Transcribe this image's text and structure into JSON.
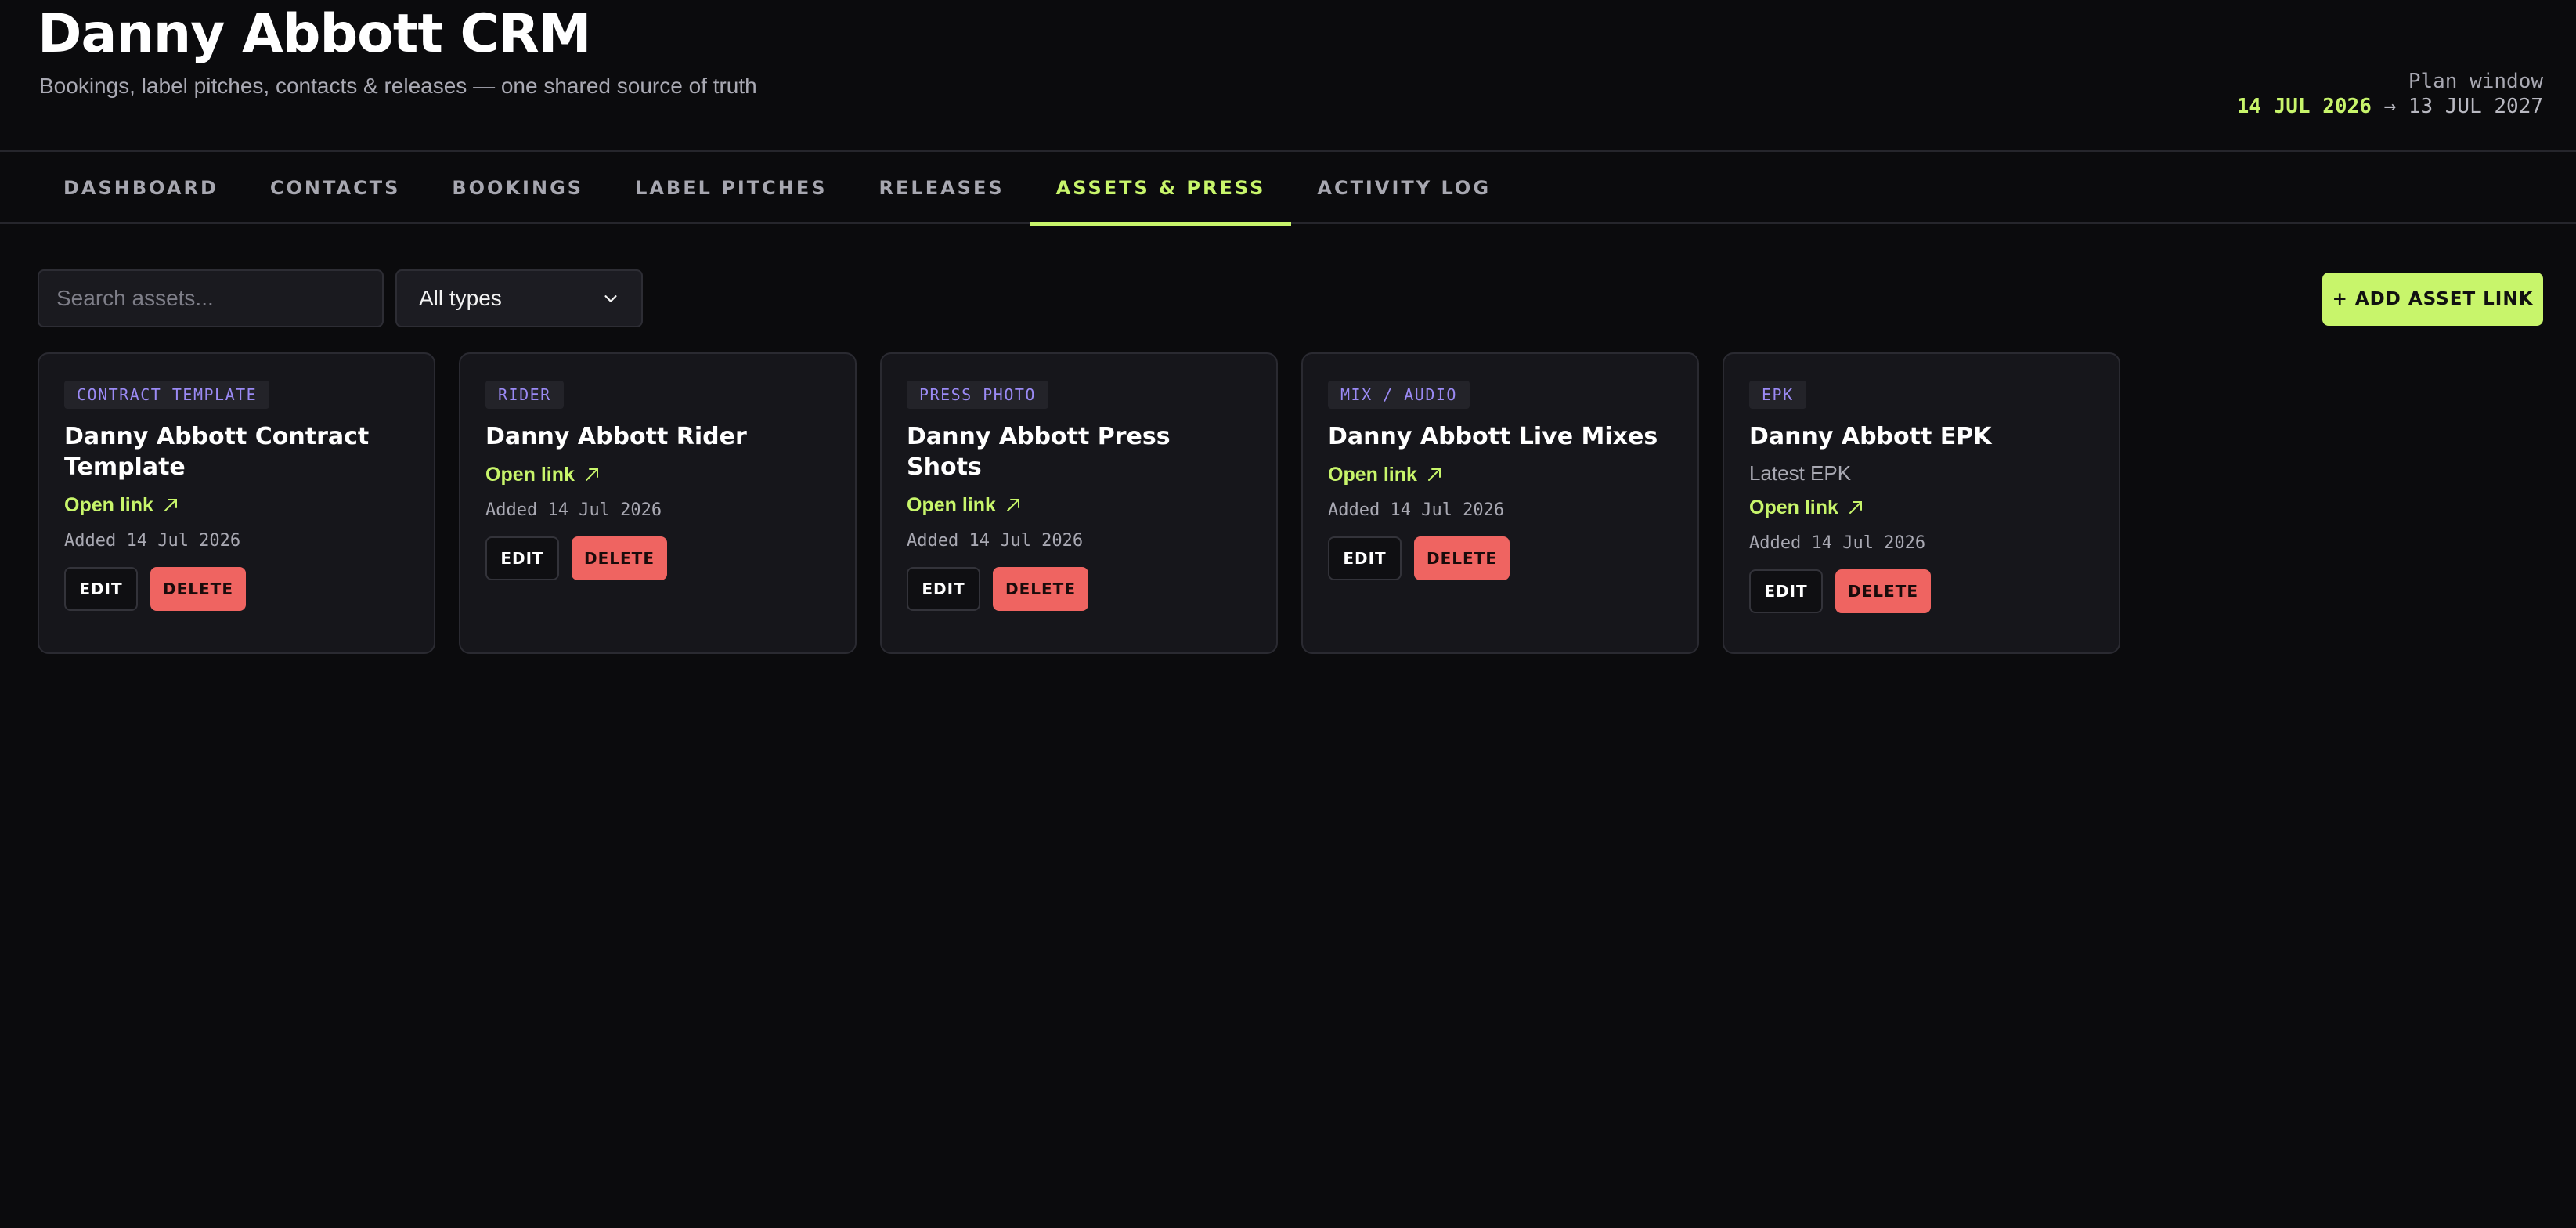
{
  "header": {
    "title": "Danny Abbott CRM",
    "subtitle": "Bookings, label pitches, contacts & releases — one shared source of truth",
    "plan_window": {
      "label": "Plan window",
      "start": "14 JUL 2026",
      "separator": " → ",
      "end": "13 JUL 2027"
    }
  },
  "tabs": [
    {
      "label": "DASHBOARD"
    },
    {
      "label": "CONTACTS"
    },
    {
      "label": "BOOKINGS"
    },
    {
      "label": "LABEL PITCHES"
    },
    {
      "label": "RELEASES"
    },
    {
      "label": "ASSETS & PRESS",
      "active": true
    },
    {
      "label": "ACTIVITY LOG"
    }
  ],
  "toolbar": {
    "search_placeholder": "Search assets...",
    "type_filter": "All types",
    "add_button": "+ ADD ASSET LINK"
  },
  "colors": {
    "accent": "#c8f56b",
    "badge_text": "#9b8af5",
    "delete": "#ef6461",
    "background": "#0b0b0d",
    "card": "#16161b"
  },
  "assets": [
    {
      "type": "CONTRACT TEMPLATE",
      "title": "Danny Abbott Contract Template",
      "note": "",
      "link_label": "Open link",
      "added": "Added 14 Jul 2026",
      "edit_label": "EDIT",
      "delete_label": "DELETE"
    },
    {
      "type": "RIDER",
      "title": "Danny Abbott Rider",
      "note": "",
      "link_label": "Open link",
      "added": "Added 14 Jul 2026",
      "edit_label": "EDIT",
      "delete_label": "DELETE"
    },
    {
      "type": "PRESS PHOTO",
      "title": "Danny Abbott Press Shots",
      "note": "",
      "link_label": "Open link",
      "added": "Added 14 Jul 2026",
      "edit_label": "EDIT",
      "delete_label": "DELETE"
    },
    {
      "type": "MIX / AUDIO",
      "title": "Danny Abbott Live Mixes",
      "note": "",
      "link_label": "Open link",
      "added": "Added 14 Jul 2026",
      "edit_label": "EDIT",
      "delete_label": "DELETE"
    },
    {
      "type": "EPK",
      "title": "Danny Abbott EPK",
      "note": "Latest EPK",
      "link_label": "Open link",
      "added": "Added 14 Jul 2026",
      "edit_label": "EDIT",
      "delete_label": "DELETE"
    }
  ],
  "icons": {
    "open_link": "external-link-arrow-icon",
    "select": "chevron-down-icon"
  }
}
